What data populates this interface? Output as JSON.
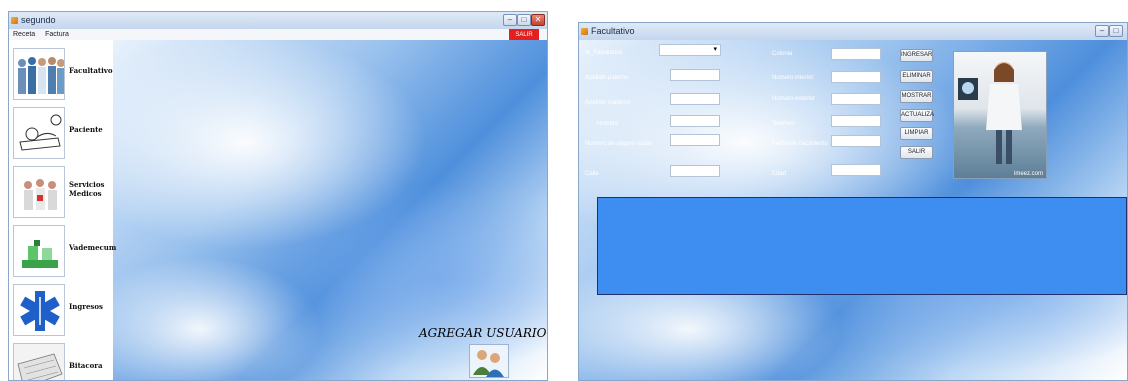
{
  "left_window": {
    "title": "segundo",
    "menu": [
      "Receta",
      "Factura"
    ],
    "salir_label": "SALIR",
    "sidebar": [
      {
        "label": "Facultativo",
        "icon": "doctors-group-icon"
      },
      {
        "label": "Paciente",
        "icon": "patient-bed-icon"
      },
      {
        "label": "Servicios Medicos",
        "icon": "medical-staff-icon"
      },
      {
        "label": "Vademecum",
        "icon": "medicine-bottles-icon"
      },
      {
        "label": "Ingresos",
        "icon": "star-of-life-icon"
      },
      {
        "label": "Bitacora",
        "icon": "logbook-icon"
      }
    ],
    "agregar_label": "AGREGAR USUARIO"
  },
  "right_window": {
    "title": "Facultativo",
    "fields_left": [
      {
        "label": "Id_Facultativo",
        "type": "combo"
      },
      {
        "label": "Apellido paterno",
        "type": "text"
      },
      {
        "label": "Apellido materno",
        "type": "text"
      },
      {
        "label": "Nombre",
        "type": "text"
      },
      {
        "label": "Numero de seguro social",
        "type": "text"
      },
      {
        "label": "Calle",
        "type": "text"
      }
    ],
    "fields_right": [
      {
        "label": "Colonia"
      },
      {
        "label": "Numero interior"
      },
      {
        "label": "Numero exterior"
      },
      {
        "label": "Telefono"
      },
      {
        "label": "Fecha de nacimiento"
      },
      {
        "label": "Edad"
      }
    ],
    "buttons": [
      "INGRESAR",
      "ELIMINAR",
      "MOSTRAR",
      "ACTUALIZA",
      "LIMPIAR",
      "SALIR"
    ],
    "photo_watermark": "imeez.com"
  },
  "colors": {
    "accent_red": "#e51e1e",
    "grid_blue": "#3d8ef0"
  }
}
